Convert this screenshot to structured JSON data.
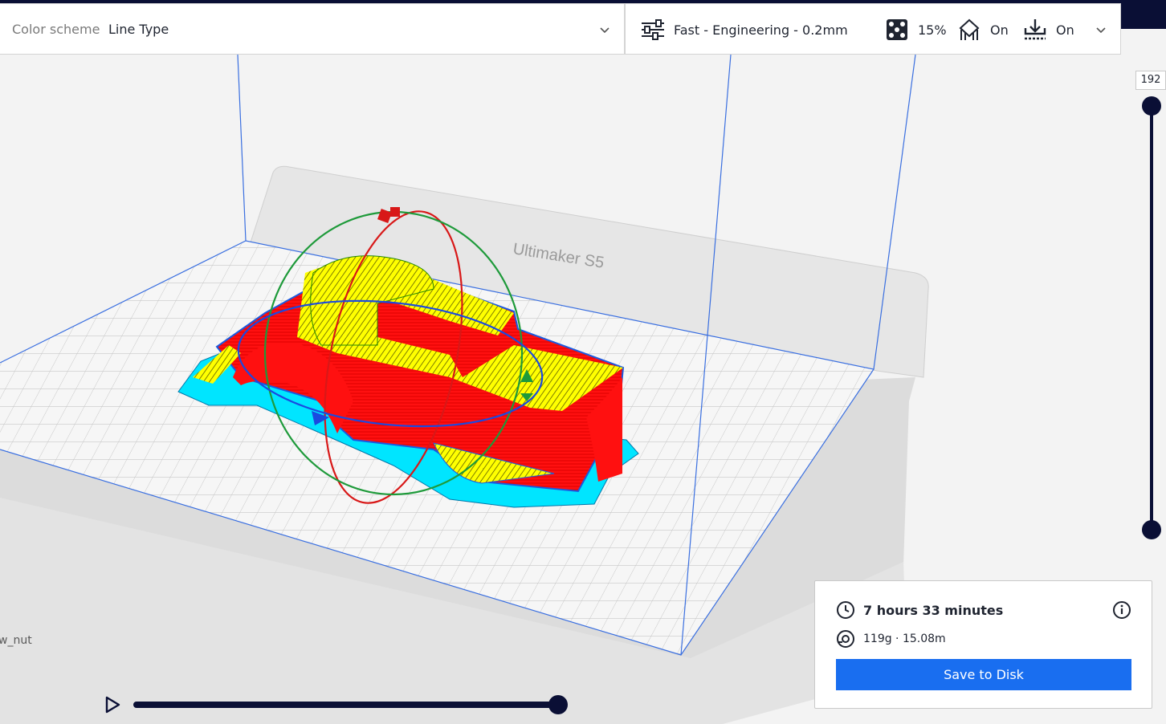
{
  "color_scheme": {
    "label": "Color scheme",
    "value": "Line Type"
  },
  "print_settings": {
    "profile": "Fast - Engineering - 0.2mm",
    "infill": "15%",
    "support": "On",
    "adhesion": "On"
  },
  "layer_view": {
    "current_layer": "192"
  },
  "printer": {
    "brand_label": "Ultimaker S5"
  },
  "object": {
    "name_fragment": "w_nut"
  },
  "estimate": {
    "time": "7 hours 33 minutes",
    "material": "119g · 15.08m",
    "save_label": "Save to Disk"
  },
  "colors": {
    "accent": "#196ef0",
    "dark": "#0a0f35",
    "wall_outer": "#ff0000",
    "skin": "#ffff00",
    "inner_wall": "#00cc00",
    "support": "#00ffff",
    "build_volume": "#3a6fe0"
  },
  "icons": {
    "profile": "sliders-icon",
    "infill": "infill-icon",
    "support": "support-icon",
    "adhesion": "adhesion-icon",
    "chevron": "chevron-down-icon",
    "clock": "clock-icon",
    "spool": "spool-icon",
    "info": "info-icon",
    "play": "play-icon"
  }
}
